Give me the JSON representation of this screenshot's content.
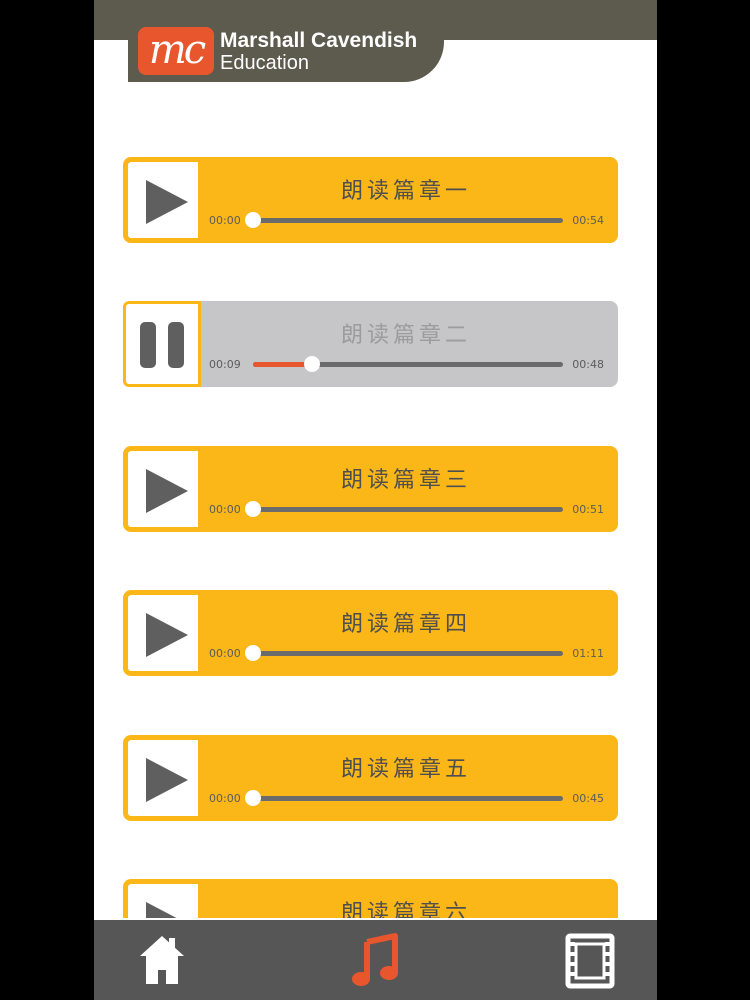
{
  "brand": {
    "name_line1": "Marshall Cavendish",
    "name_line2": "Education",
    "mark": "mc",
    "color": "#e8562d"
  },
  "colors": {
    "track": "#fbb718",
    "track_active": "#c6c5c7",
    "progress": "#e8562d",
    "bar": "#6b6b6b",
    "bottom_bar": "#565656"
  },
  "tracks": [
    {
      "title": "朗读篇章一",
      "current": "00:00",
      "duration": "00:54",
      "state": "stopped",
      "progress": 0.0
    },
    {
      "title": "朗读篇章二",
      "current": "00:09",
      "duration": "00:48",
      "state": "playing",
      "progress": 0.19
    },
    {
      "title": "朗读篇章三",
      "current": "00:00",
      "duration": "00:51",
      "state": "stopped",
      "progress": 0.0
    },
    {
      "title": "朗读篇章四",
      "current": "00:00",
      "duration": "01:11",
      "state": "stopped",
      "progress": 0.0
    },
    {
      "title": "朗读篇章五",
      "current": "00:00",
      "duration": "00:45",
      "state": "stopped",
      "progress": 0.0
    },
    {
      "title": "朗读篇章六",
      "current": "",
      "duration": "",
      "state": "stopped",
      "progress": 0.0
    }
  ],
  "bottom_nav": [
    {
      "icon": "home-icon",
      "active": false
    },
    {
      "icon": "music-icon",
      "active": true
    },
    {
      "icon": "film-icon",
      "active": false
    }
  ]
}
